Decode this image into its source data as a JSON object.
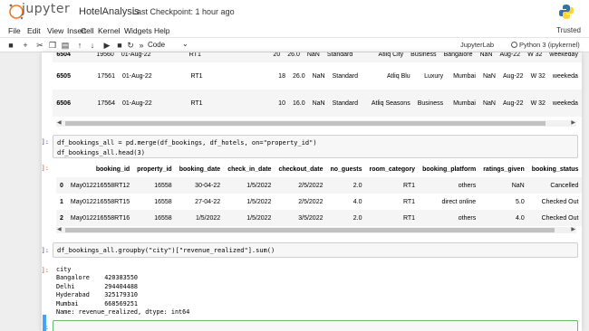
{
  "header": {
    "brand": "jupyter",
    "notebook_name": "HotelAnalysis",
    "checkpoint": "Last Checkpoint: 1 hour ago"
  },
  "menu": {
    "items": [
      "File",
      "Edit",
      "View",
      "Insert",
      "Cell",
      "Kernel",
      "Widgets",
      "Help"
    ],
    "trusted": "Trusted"
  },
  "toolbar": {
    "cell_type": "Code",
    "jupyterlab": "JupyterLab",
    "kernel": "Python 3 (ipykernel)"
  },
  "top_table": {
    "rows": [
      [
        "6504",
        "19560",
        "01-Aug-22",
        "RT1",
        "20",
        "26.0",
        "NaN",
        "Standard",
        "Atliq City",
        "Business",
        "Bangalore",
        "NaN",
        "Aug-22",
        "W 32",
        "weekeday"
      ],
      [
        "6505",
        "17561",
        "01-Aug-22",
        "RT1",
        "18",
        "26.0",
        "NaN",
        "Standard",
        "Atliq Blu",
        "Luxury",
        "Mumbai",
        "NaN",
        "Aug-22",
        "W 32",
        "weekeda"
      ],
      [
        "6506",
        "17564",
        "01-Aug-22",
        "RT1",
        "10",
        "16.0",
        "NaN",
        "Standard",
        "Atliq Seasons",
        "Business",
        "Mumbai",
        "NaN",
        "Aug-22",
        "W 32",
        "weekeda"
      ]
    ]
  },
  "cell60": {
    "prompt_in": "[60]:",
    "line1": "df_bookings_all = pd.merge(df_bookings, df_hotels, on=\"property_id\")",
    "line2": "df_bookings_all.head(3)",
    "prompt_out": "[60]:",
    "columns": [
      "",
      "booking_id",
      "property_id",
      "booking_date",
      "check_in_date",
      "checkout_date",
      "no_guests",
      "room_category",
      "booking_platform",
      "ratings_given",
      "booking_status",
      "revenue_ge"
    ],
    "rows": [
      [
        "0",
        "May012216558RT12",
        "16558",
        "30-04-22",
        "1/5/2022",
        "2/5/2022",
        "2.0",
        "RT1",
        "others",
        "NaN",
        "Cancelled",
        ""
      ],
      [
        "1",
        "May012216558RT15",
        "16558",
        "27-04-22",
        "1/5/2022",
        "2/5/2022",
        "4.0",
        "RT1",
        "direct online",
        "5.0",
        "Checked Out",
        ""
      ],
      [
        "2",
        "May012216558RT16",
        "16558",
        "1/5/2022",
        "1/5/2022",
        "3/5/2022",
        "2.0",
        "RT1",
        "others",
        "4.0",
        "Checked Out",
        ""
      ]
    ]
  },
  "cell61": {
    "prompt_in": "[61]:",
    "code": "df_bookings_all.groupby(\"city\")[\"revenue_realized\"].sum()",
    "prompt_out": "[61]:",
    "output": "city\nBangalore    420383550\nDelhi        294404488\nHyderabad    325179310\nMumbai       668569251\nName: revenue_realized, dtype: int64"
  },
  "cell_next": {
    "prompt_in": "[ ]:"
  }
}
